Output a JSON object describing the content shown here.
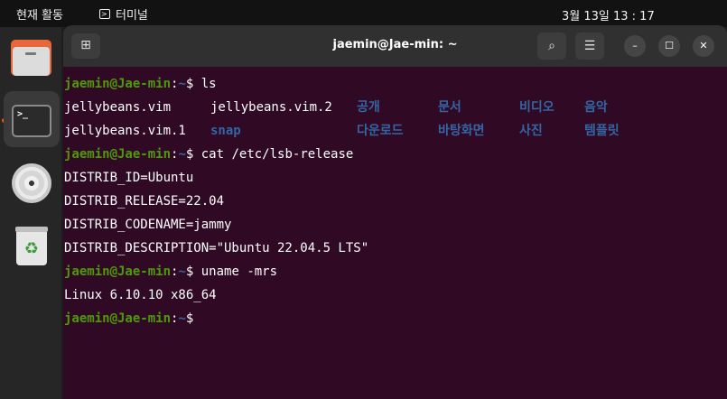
{
  "topbar": {
    "activities": "현재 활동",
    "app_name": "터미널",
    "clock": "3월 13일  13 : 17"
  },
  "dock": {
    "items": [
      "files",
      "terminal",
      "optical-disc",
      "trash"
    ],
    "terminal_glyph": ">_"
  },
  "window": {
    "title": "jaemin@Jae-min: ~",
    "buttons": {
      "new_tab": "⊞",
      "search": "⌕",
      "menu": "☰",
      "minimize": "–",
      "maximize": "☐",
      "close": "✕"
    }
  },
  "terminal": {
    "prompt_user": "jaemin@Jae-min",
    "prompt_sep": ":",
    "prompt_path": "~",
    "prompt_symbol": "$ ",
    "commands": [
      "ls",
      "cat /etc/lsb-release",
      "uname -mrs"
    ],
    "ls_files": [
      "jellybeans.vim",
      "jellybeans.vim.2",
      "jellybeans.vim.1"
    ],
    "ls_dirs": [
      "공개",
      "문서",
      "비디오",
      "음악",
      "snap",
      "다운로드",
      "바탕화면",
      "사진",
      "템플릿"
    ],
    "lsb": [
      "DISTRIB_ID=Ubuntu",
      "DISTRIB_RELEASE=22.04",
      "DISTRIB_CODENAME=jammy",
      "DISTRIB_DESCRIPTION=\"Ubuntu 22.04.5 LTS\""
    ],
    "uname": "Linux 6.10.10 x86_64"
  },
  "colors": {
    "terminal_bg": "#300a24",
    "prompt_user": "#4e9a06",
    "prompt_path": "#3465a4",
    "directory": "#3465a4",
    "accent": "#e95420"
  }
}
